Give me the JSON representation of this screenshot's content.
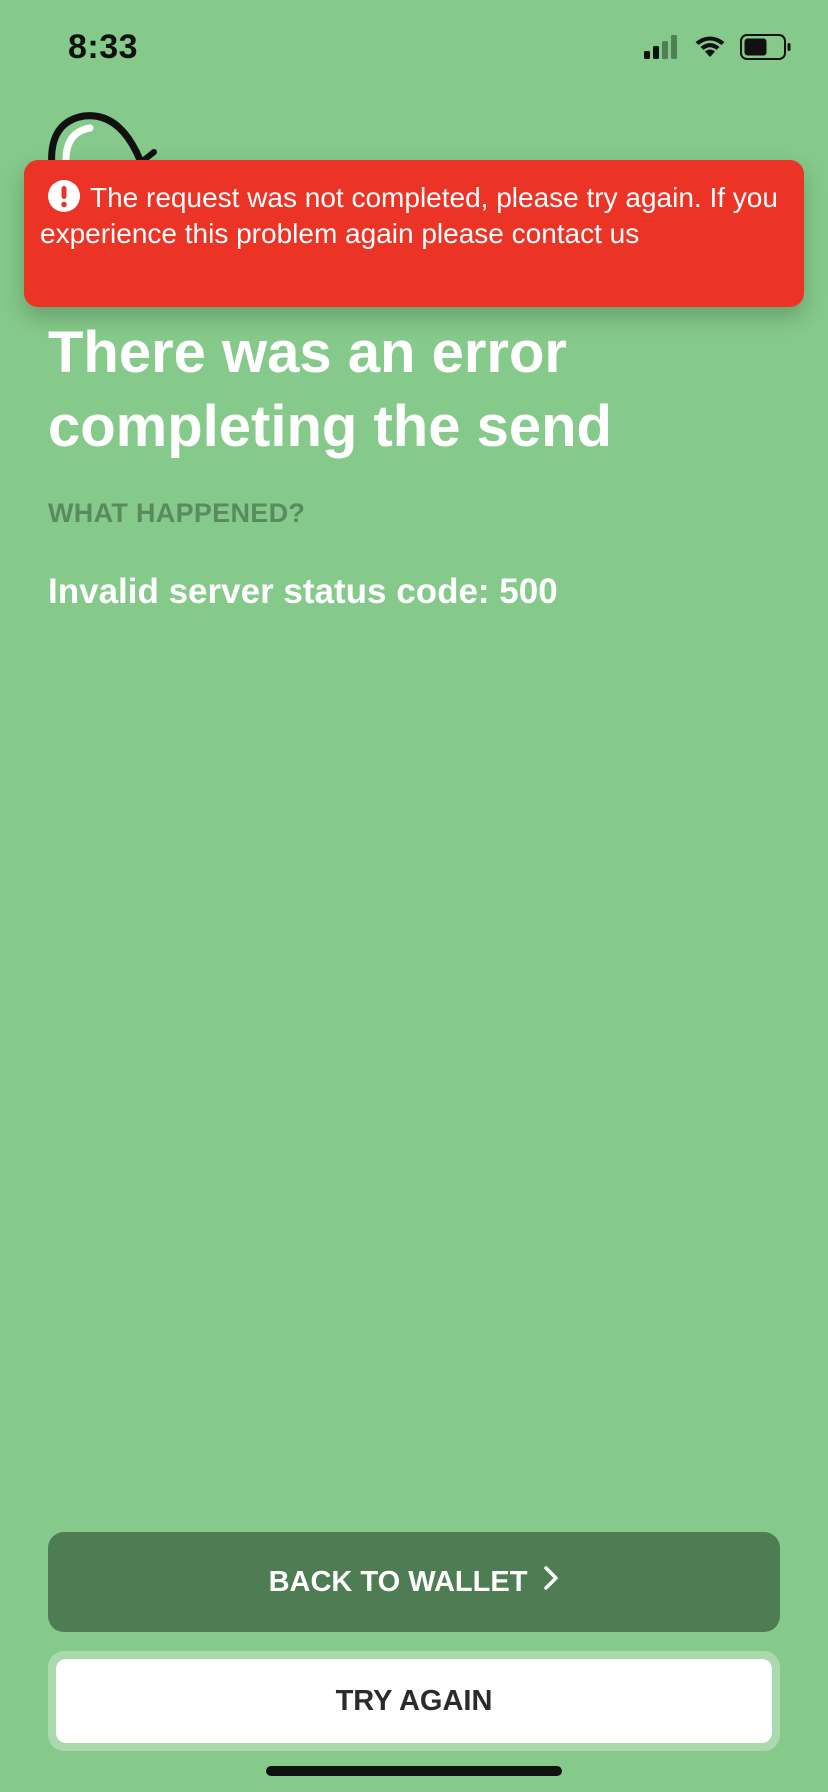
{
  "status_bar": {
    "time": "8:33"
  },
  "toast": {
    "icon": "exclamation-circle-icon",
    "message": "The request was not completed, please try again. If you experience this problem again please contact us"
  },
  "main": {
    "title": "There was an error completing the send",
    "section_label": "WHAT HAPPENED?",
    "detail": "Invalid server status code: 500"
  },
  "buttons": {
    "back_label": "BACK TO WALLET",
    "back_icon": "chevron-right-icon",
    "try_again_label": "TRY AGAIN"
  },
  "colors": {
    "background": "#85ca8a",
    "toast_bg": "#eb3425",
    "primary_button": "#4e7d53",
    "secondary_button": "#ffffff",
    "section_label": "#5a8b5e"
  }
}
